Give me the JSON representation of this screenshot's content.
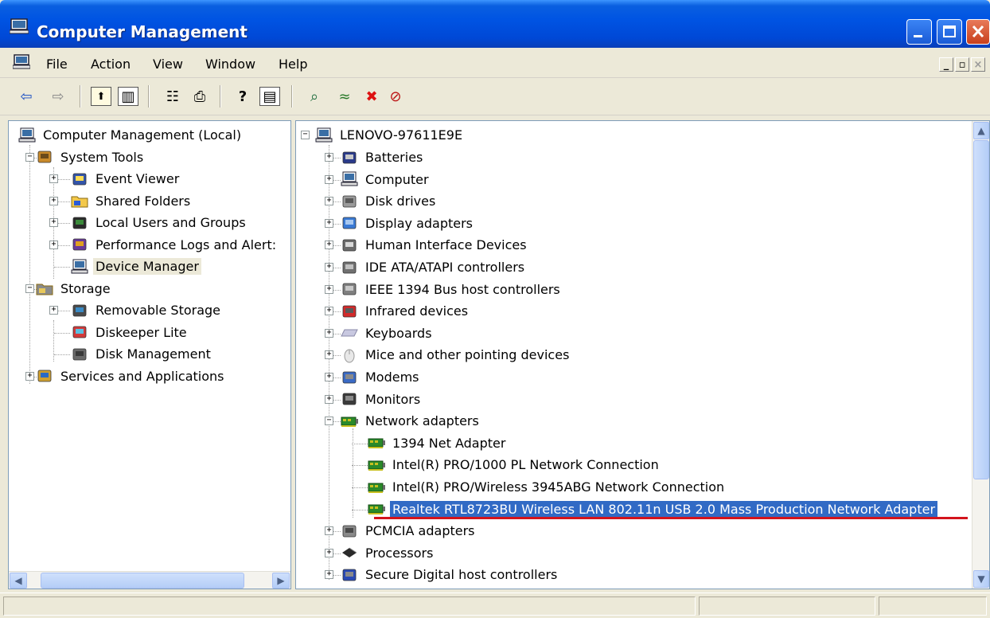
{
  "window": {
    "title": "Computer Management",
    "icon": "computer-management-icon"
  },
  "menu": {
    "items": [
      "File",
      "Action",
      "View",
      "Window",
      "Help"
    ],
    "mdi_controls": [
      "_",
      "▫",
      "×"
    ]
  },
  "toolbar": {
    "buttons": [
      {
        "name": "back-arrow-icon",
        "glyph": "⇦"
      },
      {
        "name": "forward-arrow-icon",
        "glyph": "⇨"
      },
      {
        "name": "up-one-level-icon",
        "glyph": "⬆"
      },
      {
        "name": "show-hide-console-tree-icon",
        "glyph": "▥"
      },
      {
        "name": "properties-icon",
        "glyph": "☷"
      },
      {
        "name": "print-icon",
        "glyph": "⎙"
      },
      {
        "name": "help-icon",
        "glyph": "?"
      },
      {
        "name": "show-hide-action-pane-icon",
        "glyph": "▤"
      },
      {
        "name": "scan-hardware-icon",
        "glyph": "⌕"
      },
      {
        "name": "update-driver-icon",
        "glyph": "≈"
      },
      {
        "name": "uninstall-icon",
        "glyph": "✖"
      },
      {
        "name": "disable-icon",
        "glyph": "⊘"
      }
    ]
  },
  "left_tree": [
    {
      "label": "Computer Management (Local)",
      "icon": "computer-icon",
      "level": 0,
      "expander": ""
    },
    {
      "label": "System Tools",
      "icon": "toolbox-icon",
      "level": 1,
      "expander": "−"
    },
    {
      "label": "Event Viewer",
      "icon": "event-viewer-icon",
      "level": 2,
      "expander": "+"
    },
    {
      "label": "Shared Folders",
      "icon": "shared-folder-icon",
      "level": 2,
      "expander": "+"
    },
    {
      "label": "Local Users and Groups",
      "icon": "users-icon",
      "level": 2,
      "expander": "+"
    },
    {
      "label": "Performance Logs and Alert:",
      "icon": "performance-icon",
      "level": 2,
      "expander": "+"
    },
    {
      "label": "Device Manager",
      "icon": "device-manager-icon",
      "level": 2,
      "expander": "",
      "selected": true
    },
    {
      "label": "Storage",
      "icon": "storage-icon",
      "level": 1,
      "expander": "−"
    },
    {
      "label": "Removable Storage",
      "icon": "removable-storage-icon",
      "level": 2,
      "expander": "+"
    },
    {
      "label": "Diskeeper Lite",
      "icon": "diskeeper-icon",
      "level": 2,
      "expander": ""
    },
    {
      "label": "Disk Management",
      "icon": "disk-management-icon",
      "level": 2,
      "expander": ""
    },
    {
      "label": "Services and Applications",
      "icon": "services-icon",
      "level": 1,
      "expander": "+"
    }
  ],
  "device_tree": {
    "root": {
      "label": "LENOVO-97611E9E",
      "icon": "computer-icon",
      "expander": "−"
    },
    "categories": [
      {
        "label": "Batteries",
        "icon": "battery-icon",
        "expander": "+"
      },
      {
        "label": "Computer",
        "icon": "computer-icon",
        "expander": "+"
      },
      {
        "label": "Disk drives",
        "icon": "disk-drive-icon",
        "expander": "+"
      },
      {
        "label": "Display adapters",
        "icon": "display-adapter-icon",
        "expander": "+"
      },
      {
        "label": "Human Interface Devices",
        "icon": "hid-icon",
        "expander": "+"
      },
      {
        "label": "IDE ATA/ATAPI controllers",
        "icon": "ide-controller-icon",
        "expander": "+"
      },
      {
        "label": "IEEE 1394 Bus host controllers",
        "icon": "ieee1394-icon",
        "expander": "+"
      },
      {
        "label": "Infrared devices",
        "icon": "infrared-icon",
        "expander": "+"
      },
      {
        "label": "Keyboards",
        "icon": "keyboard-icon",
        "expander": "+"
      },
      {
        "label": "Mice and other pointing devices",
        "icon": "mouse-icon",
        "expander": "+"
      },
      {
        "label": "Modems",
        "icon": "modem-icon",
        "expander": "+"
      },
      {
        "label": "Monitors",
        "icon": "monitor-icon",
        "expander": "+"
      },
      {
        "label": "Network adapters",
        "icon": "network-adapter-icon",
        "expander": "−"
      },
      {
        "label": "1394 Net Adapter",
        "icon": "network-adapter-icon",
        "child": true
      },
      {
        "label": "Intel(R) PRO/1000 PL Network Connection",
        "icon": "network-adapter-icon",
        "child": true
      },
      {
        "label": "Intel(R) PRO/Wireless 3945ABG Network Connection",
        "icon": "network-adapter-icon",
        "child": true
      },
      {
        "label": "Realtek RTL8723BU Wireless LAN 802.11n USB 2.0 Mass Production Network Adapter",
        "icon": "network-adapter-icon",
        "child": true,
        "selected": true
      },
      {
        "label": "PCMCIA adapters",
        "icon": "pcmcia-icon",
        "expander": "+"
      },
      {
        "label": "Processors",
        "icon": "processor-icon",
        "expander": "+"
      },
      {
        "label": "Secure Digital host controllers",
        "icon": "sd-controller-icon",
        "expander": "+"
      }
    ]
  },
  "colors": {
    "title_bar": "#0054e3",
    "selection": "#316ac5",
    "highlight_underline": "#d3141c",
    "window_bg": "#ece9d8"
  }
}
